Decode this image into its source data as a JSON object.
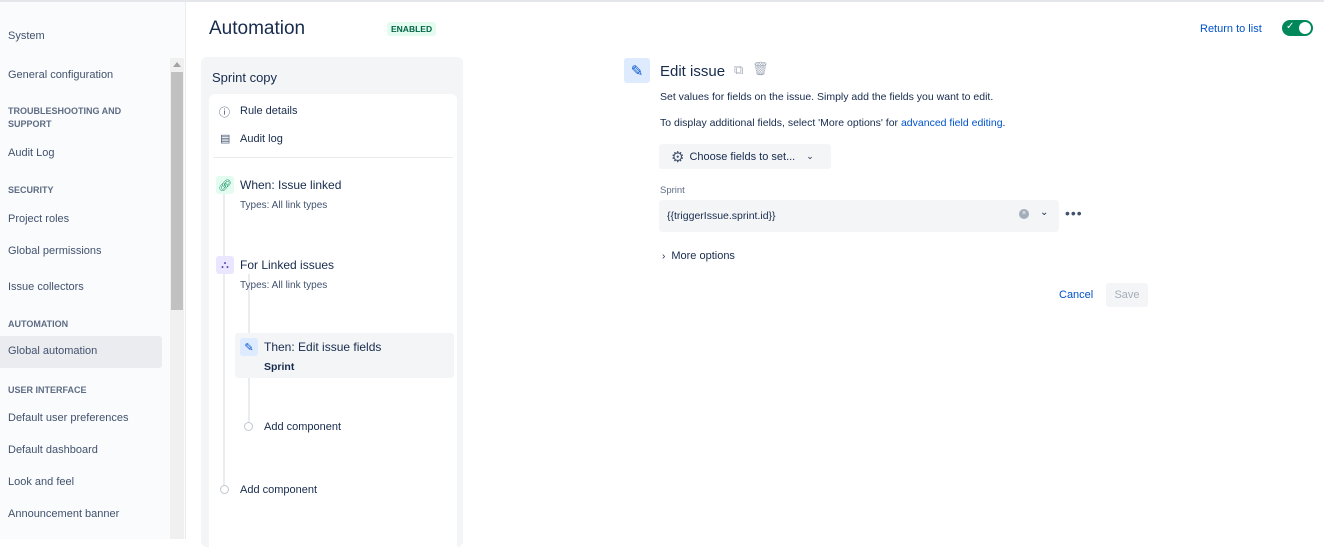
{
  "sidebar": {
    "items": [
      {
        "label": "System"
      },
      {
        "label": "General configuration"
      },
      {
        "heading": "TROUBLESHOOTING AND SUPPORT"
      },
      {
        "label": "Audit Log"
      },
      {
        "heading": "SECURITY"
      },
      {
        "label": "Project roles"
      },
      {
        "label": "Global permissions"
      },
      {
        "label": "Issue collectors"
      },
      {
        "heading": "AUTOMATION"
      },
      {
        "label": "Global automation"
      },
      {
        "heading": "USER INTERFACE"
      },
      {
        "label": "Default user preferences"
      },
      {
        "label": "Default dashboard"
      },
      {
        "label": "Look and feel"
      },
      {
        "label": "Announcement banner"
      }
    ]
  },
  "header": {
    "title": "Automation",
    "status": "ENABLED",
    "return_link": "Return to list"
  },
  "rule": {
    "name": "Sprint copy",
    "menu": [
      {
        "label": "Rule details"
      },
      {
        "label": "Audit log"
      }
    ],
    "trigger": {
      "title": "When: Issue linked",
      "sub": "Types: All link types"
    },
    "branch": {
      "title": "For Linked issues",
      "sub": "Types: All link types"
    },
    "action": {
      "title": "Then: Edit issue fields",
      "sub": "Sprint"
    },
    "add_inner": "Add component",
    "add_outer": "Add component"
  },
  "editor": {
    "title": "Edit issue",
    "desc1": "Set values for fields on the issue. Simply add the fields you want to edit.",
    "desc2_prefix": "To display additional fields, select 'More options' for ",
    "desc2_link": "advanced field editing",
    "desc2_suffix": ".",
    "choose_fields": "Choose fields to set...",
    "field_label": "Sprint",
    "field_value": "{{triggerIssue.sprint.id}}",
    "more_options": "More options",
    "cancel": "Cancel",
    "save": "Save"
  }
}
